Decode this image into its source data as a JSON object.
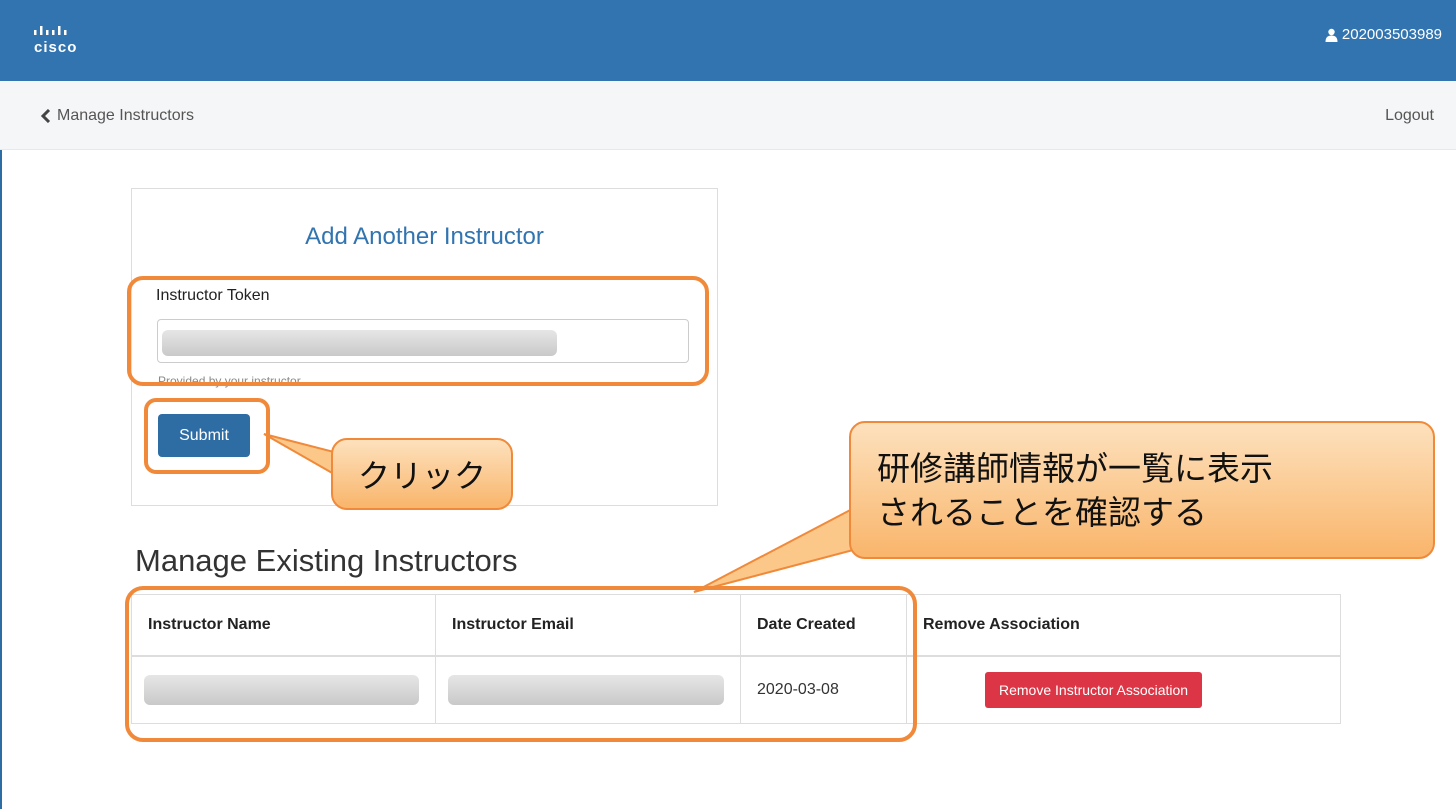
{
  "header": {
    "logo_text": "cisco",
    "user_id": "202003503989"
  },
  "subnav": {
    "back_label": "Manage Instructors",
    "logout_label": "Logout"
  },
  "add_card": {
    "title": "Add Another Instructor",
    "token_label": "Instructor Token",
    "token_help": "Provided by your instructor",
    "submit_label": "Submit"
  },
  "manage": {
    "title": "Manage Existing Instructors",
    "columns": [
      "Instructor Name",
      "Instructor Email",
      "Date Created",
      "Remove Association"
    ],
    "rows": [
      {
        "name": "",
        "email": "",
        "date_created": "2020-03-08",
        "remove_label": "Remove Instructor Association"
      }
    ]
  },
  "annotations": {
    "click_callout": "クリック",
    "list_callout_line1": "研修講師情報が一覧に表示",
    "list_callout_line2": "されることを確認する"
  },
  "colors": {
    "header_bg": "#3174b0",
    "primary": "#2e6da4",
    "danger": "#dc3545",
    "annotation_orange": "#f08a3a"
  }
}
